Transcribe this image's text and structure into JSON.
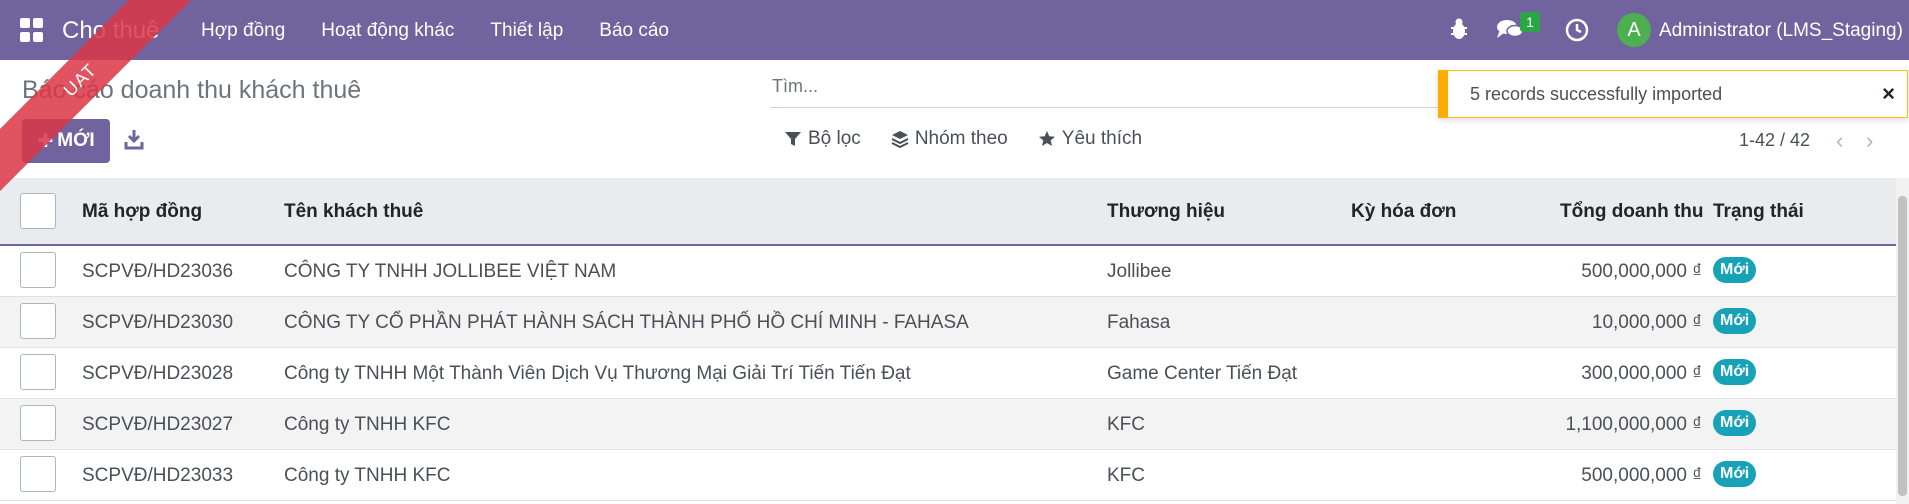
{
  "navbar": {
    "brand": "Cho thuê",
    "menu": [
      "Hợp đồng",
      "Hoạt động khác",
      "Thiết lập",
      "Báo cáo"
    ],
    "chat_count": "1",
    "avatar_letter": "A",
    "user_name": "Administrator (LMS_Staging)",
    "bg_color": "#71639e"
  },
  "ribbon": "UAT",
  "page": {
    "title": "Báo cáo doanh thu khách thuê",
    "new_button": "MỚI",
    "search_placeholder": "Tìm...",
    "filters": [
      "Bộ lọc",
      "Nhóm theo",
      "Yêu thích"
    ],
    "pager": "1-42 / 42"
  },
  "toast": {
    "message": "5 records successfully imported",
    "close": "×"
  },
  "table": {
    "columns": [
      "Mã hợp đồng",
      "Tên khách thuê",
      "Thương hiệu",
      "Kỳ hóa đơn",
      "Tổng doanh thu",
      "Trạng thái"
    ],
    "rows": [
      {
        "code": "SCPVĐ/HD23036",
        "tenant": "CÔNG TY TNHH JOLLIBEE VIỆT NAM",
        "brand": "Jollibee",
        "period": "",
        "revenue": "500,000,000 ₫",
        "status": "Mới"
      },
      {
        "code": "SCPVĐ/HD23030",
        "tenant": "CÔNG TY CỔ PHẦN PHÁT HÀNH SÁCH THÀNH PHỐ HỒ CHÍ MINH - FAHASA",
        "brand": "Fahasa",
        "period": "",
        "revenue": "10,000,000 ₫",
        "status": "Mới"
      },
      {
        "code": "SCPVĐ/HD23028",
        "tenant": "Công ty TNHH Một Thành Viên Dịch Vụ Thương Mại Giải Trí Tiến Tiến Đạt",
        "brand": "Game Center Tiến Đạt",
        "period": "",
        "revenue": "300,000,000 ₫",
        "status": "Mới"
      },
      {
        "code": "SCPVĐ/HD23027",
        "tenant": "Công ty TNHH KFC",
        "brand": "KFC",
        "period": "",
        "revenue": "1,100,000,000 ₫",
        "status": "Mới"
      },
      {
        "code": "SCPVĐ/HD23033",
        "tenant": "Công ty TNHH KFC",
        "brand": "KFC",
        "period": "",
        "revenue": "500,000,000 ₫",
        "status": "Mới"
      }
    ]
  }
}
